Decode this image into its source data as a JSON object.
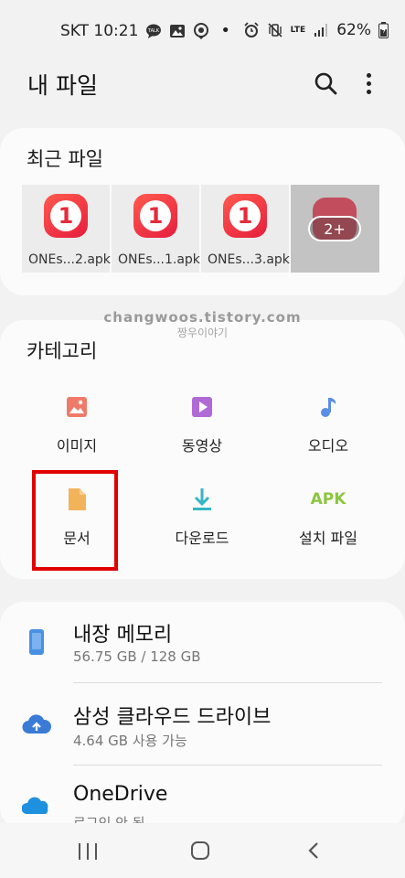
{
  "status_bar": {
    "carrier_time": "SKT 10:21",
    "dot": "•",
    "signal_label": "LTE",
    "battery": "62%"
  },
  "app_bar": {
    "title": "내 파일",
    "search_icon": "search-icon",
    "more_icon": "more-vertical-icon"
  },
  "recent": {
    "title": "최근 파일",
    "files": [
      {
        "name": "ONEs...2.apk",
        "icon_text": "1"
      },
      {
        "name": "ONEs...1.apk",
        "icon_text": "1"
      },
      {
        "name": "ONEs...3.apk",
        "icon_text": "1"
      }
    ],
    "more_badge": "2+"
  },
  "watermark": {
    "line1": "changwoos.tistory.com",
    "line2": "짱우이야기"
  },
  "categories": {
    "title": "카테고리",
    "items": [
      {
        "label": "이미지",
        "icon": "image-icon",
        "color": "#f07a6a"
      },
      {
        "label": "동영상",
        "icon": "video-icon",
        "color": "#b06ad6"
      },
      {
        "label": "오디오",
        "icon": "audio-icon",
        "color": "#5b8ee6"
      },
      {
        "label": "문서",
        "icon": "document-icon",
        "color": "#f2b45a"
      },
      {
        "label": "다운로드",
        "icon": "download-icon",
        "color": "#35b6c4"
      },
      {
        "label": "설치 파일",
        "icon": "apk-icon",
        "icon_text": "APK",
        "color": "#8dc63f"
      }
    ],
    "highlight_color": "#e10000"
  },
  "storage": {
    "items": [
      {
        "name": "내장 메모리",
        "sub": "56.75 GB / 128 GB",
        "icon": "phone-icon"
      },
      {
        "name": "삼성 클라우드 드라이브",
        "sub": "4.64 GB 사용 가능",
        "icon": "cloud-upload-icon"
      },
      {
        "name": "OneDrive",
        "sub": "로그인 안 됨",
        "icon": "onedrive-icon"
      }
    ]
  },
  "nav_bar": {
    "recent_icon": "recent-apps-icon",
    "home_icon": "home-icon",
    "back_icon": "back-icon"
  }
}
